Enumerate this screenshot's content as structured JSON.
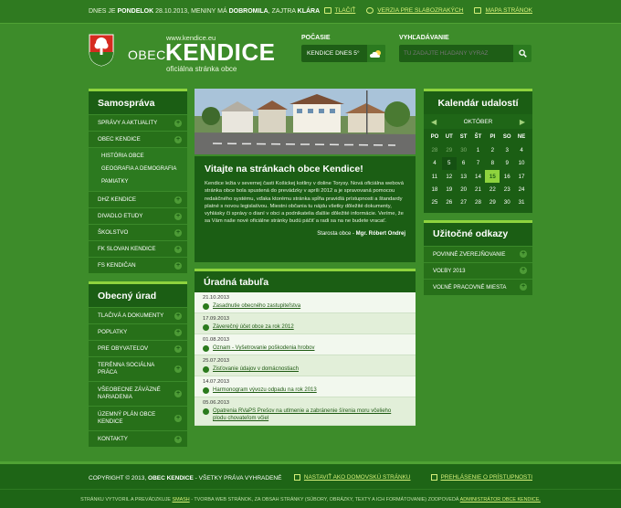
{
  "topbar": {
    "date_prefix": "DNES JE",
    "day": "PONDELOK",
    "date": "28.10.2013,",
    "nameday_prefix": "MENINY MÁ",
    "nameday": "DOBROMILA",
    "tomorrow_prefix": ", ZAJTRA",
    "tomorrow_name": "KLÁRA",
    "links": [
      {
        "label": "TLAČIŤ",
        "icon": "print-icon"
      },
      {
        "label": "VERZIA PRE SLABOZRAKÝCH",
        "icon": "eye-icon"
      },
      {
        "label": "MAPA STRÁNOK",
        "icon": "sitemap-icon"
      }
    ]
  },
  "header": {
    "obec_word": "OBEC",
    "url": "www.kendice.eu",
    "name": "KENDICE",
    "subtitle": "oficiálna stránka obce",
    "weather_label": "POČASIE",
    "weather_text": "KENDICE DNES 5°",
    "search_label": "VYHĽADÁVANIE",
    "search_placeholder": "TU ZADAJTE HĽADANÝ VÝRAZ"
  },
  "left": {
    "samosprava": {
      "title": "Samospráva",
      "items": [
        {
          "label": "SPRÁVY A AKTUALITY"
        },
        {
          "label": "OBEC KENDICE"
        }
      ],
      "subitems": [
        "HISTÓRIA OBCE",
        "GEOGRAFIA A DEMOGRAFIA",
        "PAMIATKY"
      ],
      "items_after": [
        {
          "label": "DHZ KENDICE"
        },
        {
          "label": "DIVADLO ETUDY"
        },
        {
          "label": "ŠKOLSTVO"
        },
        {
          "label": "FK SLOVAN KENDICE"
        },
        {
          "label": "FS KENDIČAN"
        }
      ]
    },
    "urad": {
      "title": "Obecný úrad",
      "items": [
        {
          "label": "TLAČIVÁ A DOKUMENTY"
        },
        {
          "label": "POPLATKY"
        },
        {
          "label": "PRE OBYVATEĽOV"
        },
        {
          "label": "TERÉNNA SOCIÁLNA PRÁCA"
        },
        {
          "label": "VŠEOBECNE ZÁVÄZNÉ NARIADENIA"
        },
        {
          "label": "ÚZEMNÝ PLÁN OBCE KENDICE"
        },
        {
          "label": "KONTAKTY"
        }
      ]
    }
  },
  "welcome": {
    "title": "Vitajte na stránkach obce Kendice!",
    "text": "Kendice ležia v severnej časti Košickej kotliny v doline Torysy. Nová oficiálna webová stránka obce bola spustená do prevádzky v apríli 2012 a je spravovaná pomocou redakčného systému, vďaka ktorému stránka spĺňa pravidlá prístupnosti a štandardy platné s novou legislatívou. Miestni občania tu nájdu všetky dôležité dokumenty, vyhlásky či správy o dianí v obci a podnikatelia ďalšie dôležité informácie. Veríme, že sa Vám naše nové oficiálne stránky budú páčiť a radi sa na ne budete vracať.",
    "signature_prefix": "Starosta obce -",
    "signature_name": "Mgr. Róbert Ondrej"
  },
  "board": {
    "title": "Úradná tabuľa",
    "notices": [
      {
        "date": "21.10.2013",
        "text": "Zasadnutie obecného zastupiteľstva"
      },
      {
        "date": "17.09.2013",
        "text": "Záverečný účet obce za rok 2012"
      },
      {
        "date": "01.08.2013",
        "text": "Oznam - Vyšetrovanie poškodenia hrobov"
      },
      {
        "date": "25.07.2013",
        "text": "Zisťovanie údajov v domácnostiach"
      },
      {
        "date": "14.07.2013",
        "text": "Harmonogram vývozu odpadu na rok 2013"
      },
      {
        "date": "05.06.2013",
        "text": "Opatrenia RVaPS Prešov na utlmenie a zabránenie šírenia moru včelieho plodu chovateľom včiel"
      }
    ]
  },
  "calendar": {
    "title": "Kalendár udalostí",
    "month": "OKTÓBER",
    "weekdays": [
      "PO",
      "UT",
      "ST",
      "ŠT",
      "PI",
      "SO",
      "NE"
    ],
    "days": [
      {
        "d": "28",
        "dim": true
      },
      {
        "d": "29",
        "dim": true
      },
      {
        "d": "30",
        "dim": true
      },
      {
        "d": "1"
      },
      {
        "d": "2"
      },
      {
        "d": "3"
      },
      {
        "d": "4"
      },
      {
        "d": "4"
      },
      {
        "d": "5",
        "event": true
      },
      {
        "d": "6"
      },
      {
        "d": "7"
      },
      {
        "d": "8"
      },
      {
        "d": "9"
      },
      {
        "d": "10"
      },
      {
        "d": "11"
      },
      {
        "d": "12"
      },
      {
        "d": "13"
      },
      {
        "d": "14"
      },
      {
        "d": "15",
        "today": true
      },
      {
        "d": "16"
      },
      {
        "d": "17"
      },
      {
        "d": "18"
      },
      {
        "d": "19"
      },
      {
        "d": "20"
      },
      {
        "d": "21"
      },
      {
        "d": "22"
      },
      {
        "d": "23"
      },
      {
        "d": "24"
      },
      {
        "d": "25"
      },
      {
        "d": "26"
      },
      {
        "d": "27"
      },
      {
        "d": "28"
      },
      {
        "d": "29"
      },
      {
        "d": "30"
      },
      {
        "d": "31"
      }
    ]
  },
  "useful_links": {
    "title": "Užitočné odkazy",
    "items": [
      {
        "label": "POVINNÉ ZVEREJŇOVANIE"
      },
      {
        "label": "VOĽBY 2013"
      },
      {
        "label": "VOĽNÉ PRACOVNÉ MIESTA"
      }
    ]
  },
  "footer": {
    "copy_prefix": "COPYRIGHT © 2013,",
    "copy_name": "OBEC KENDICE",
    "copy_suffix": "- VŠETKY PRÁVA VYHRADENÉ",
    "links": [
      "NASTAVIŤ AKO DOMOVSKÚ STRÁNKU",
      "PREHLÁSENIE O PRÍSTUPNOSTI"
    ],
    "credit_1": "STRÁNKU VYTVORIL A PREVÁDZKUJE",
    "credit_link_1": "SMASH",
    "credit_2": "- TVORBA WEB STRÁNOK, ZA OBSAH STRÁNKY (SÚBORY, OBRÁZKY, TEXTY A ICH FORMÁTOVANIE) ZODPOVEDÁ",
    "credit_link_2": "ADMINISTRÁTOR OBCE KENDICE."
  },
  "colors": {
    "background": "#3d8c2a",
    "panel": "#1b5e14",
    "accent": "#8ed33e",
    "link": "#d6f07a"
  }
}
